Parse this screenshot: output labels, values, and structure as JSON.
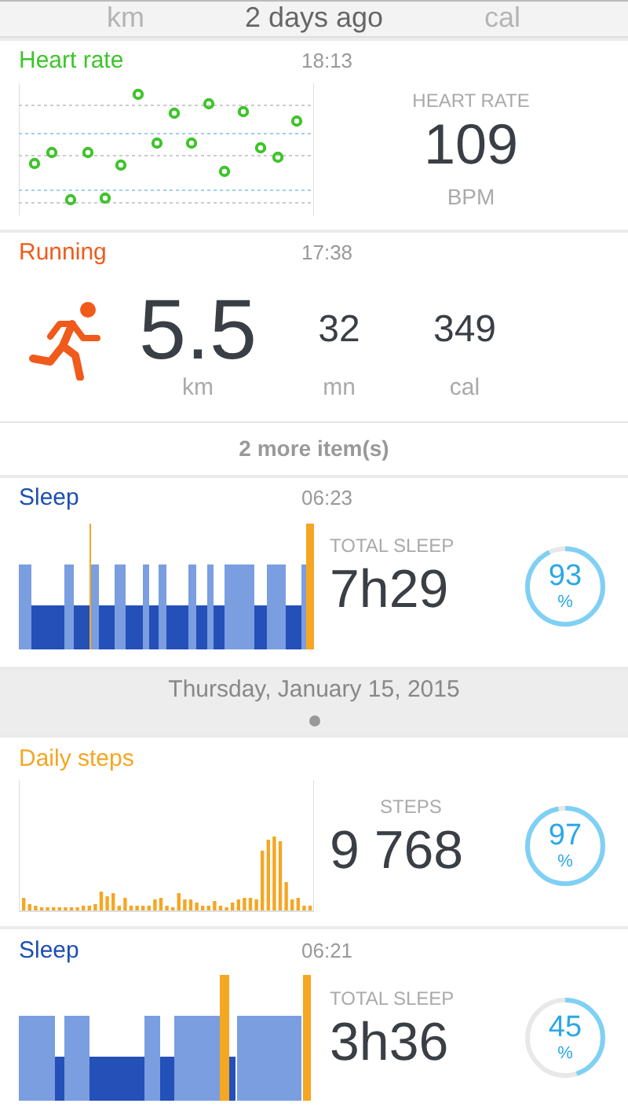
{
  "header": {
    "label": "2 days ago",
    "faded_units": [
      "km",
      "cal"
    ]
  },
  "cards": [
    {
      "kind": "heart_rate",
      "title": "Heart rate",
      "color": "#3ec42b",
      "time": "18:13",
      "stat_label": "HEART RATE",
      "value": "109",
      "unit": "BPM"
    },
    {
      "kind": "running",
      "title": "Running",
      "color": "#f05a1a",
      "time": "17:38",
      "metrics": [
        {
          "value": "5.5",
          "unit": "km"
        },
        {
          "value": "32",
          "unit": "mn"
        },
        {
          "value": "349",
          "unit": "cal"
        }
      ],
      "more": "2 more item(s)"
    },
    {
      "kind": "sleep",
      "title": "Sleep",
      "color": "#1e4fb4",
      "time": "06:23",
      "stat_label": "TOTAL SLEEP",
      "value": "7h29",
      "percent": "93",
      "percent_sign": "%",
      "level": 0.93
    },
    {
      "kind": "date",
      "label": "Thursday, January 15, 2015"
    },
    {
      "kind": "steps",
      "title": "Daily steps",
      "color": "#f5a623",
      "stat_label": "STEPS",
      "value": "9 768",
      "percent": "97",
      "percent_sign": "%",
      "level": 0.97
    },
    {
      "kind": "sleep",
      "title": "Sleep",
      "color": "#1e4fb4",
      "time": "06:21",
      "stat_label": "TOTAL SLEEP",
      "value": "3h36",
      "percent": "45",
      "percent_sign": "%",
      "level": 0.45
    }
  ]
}
